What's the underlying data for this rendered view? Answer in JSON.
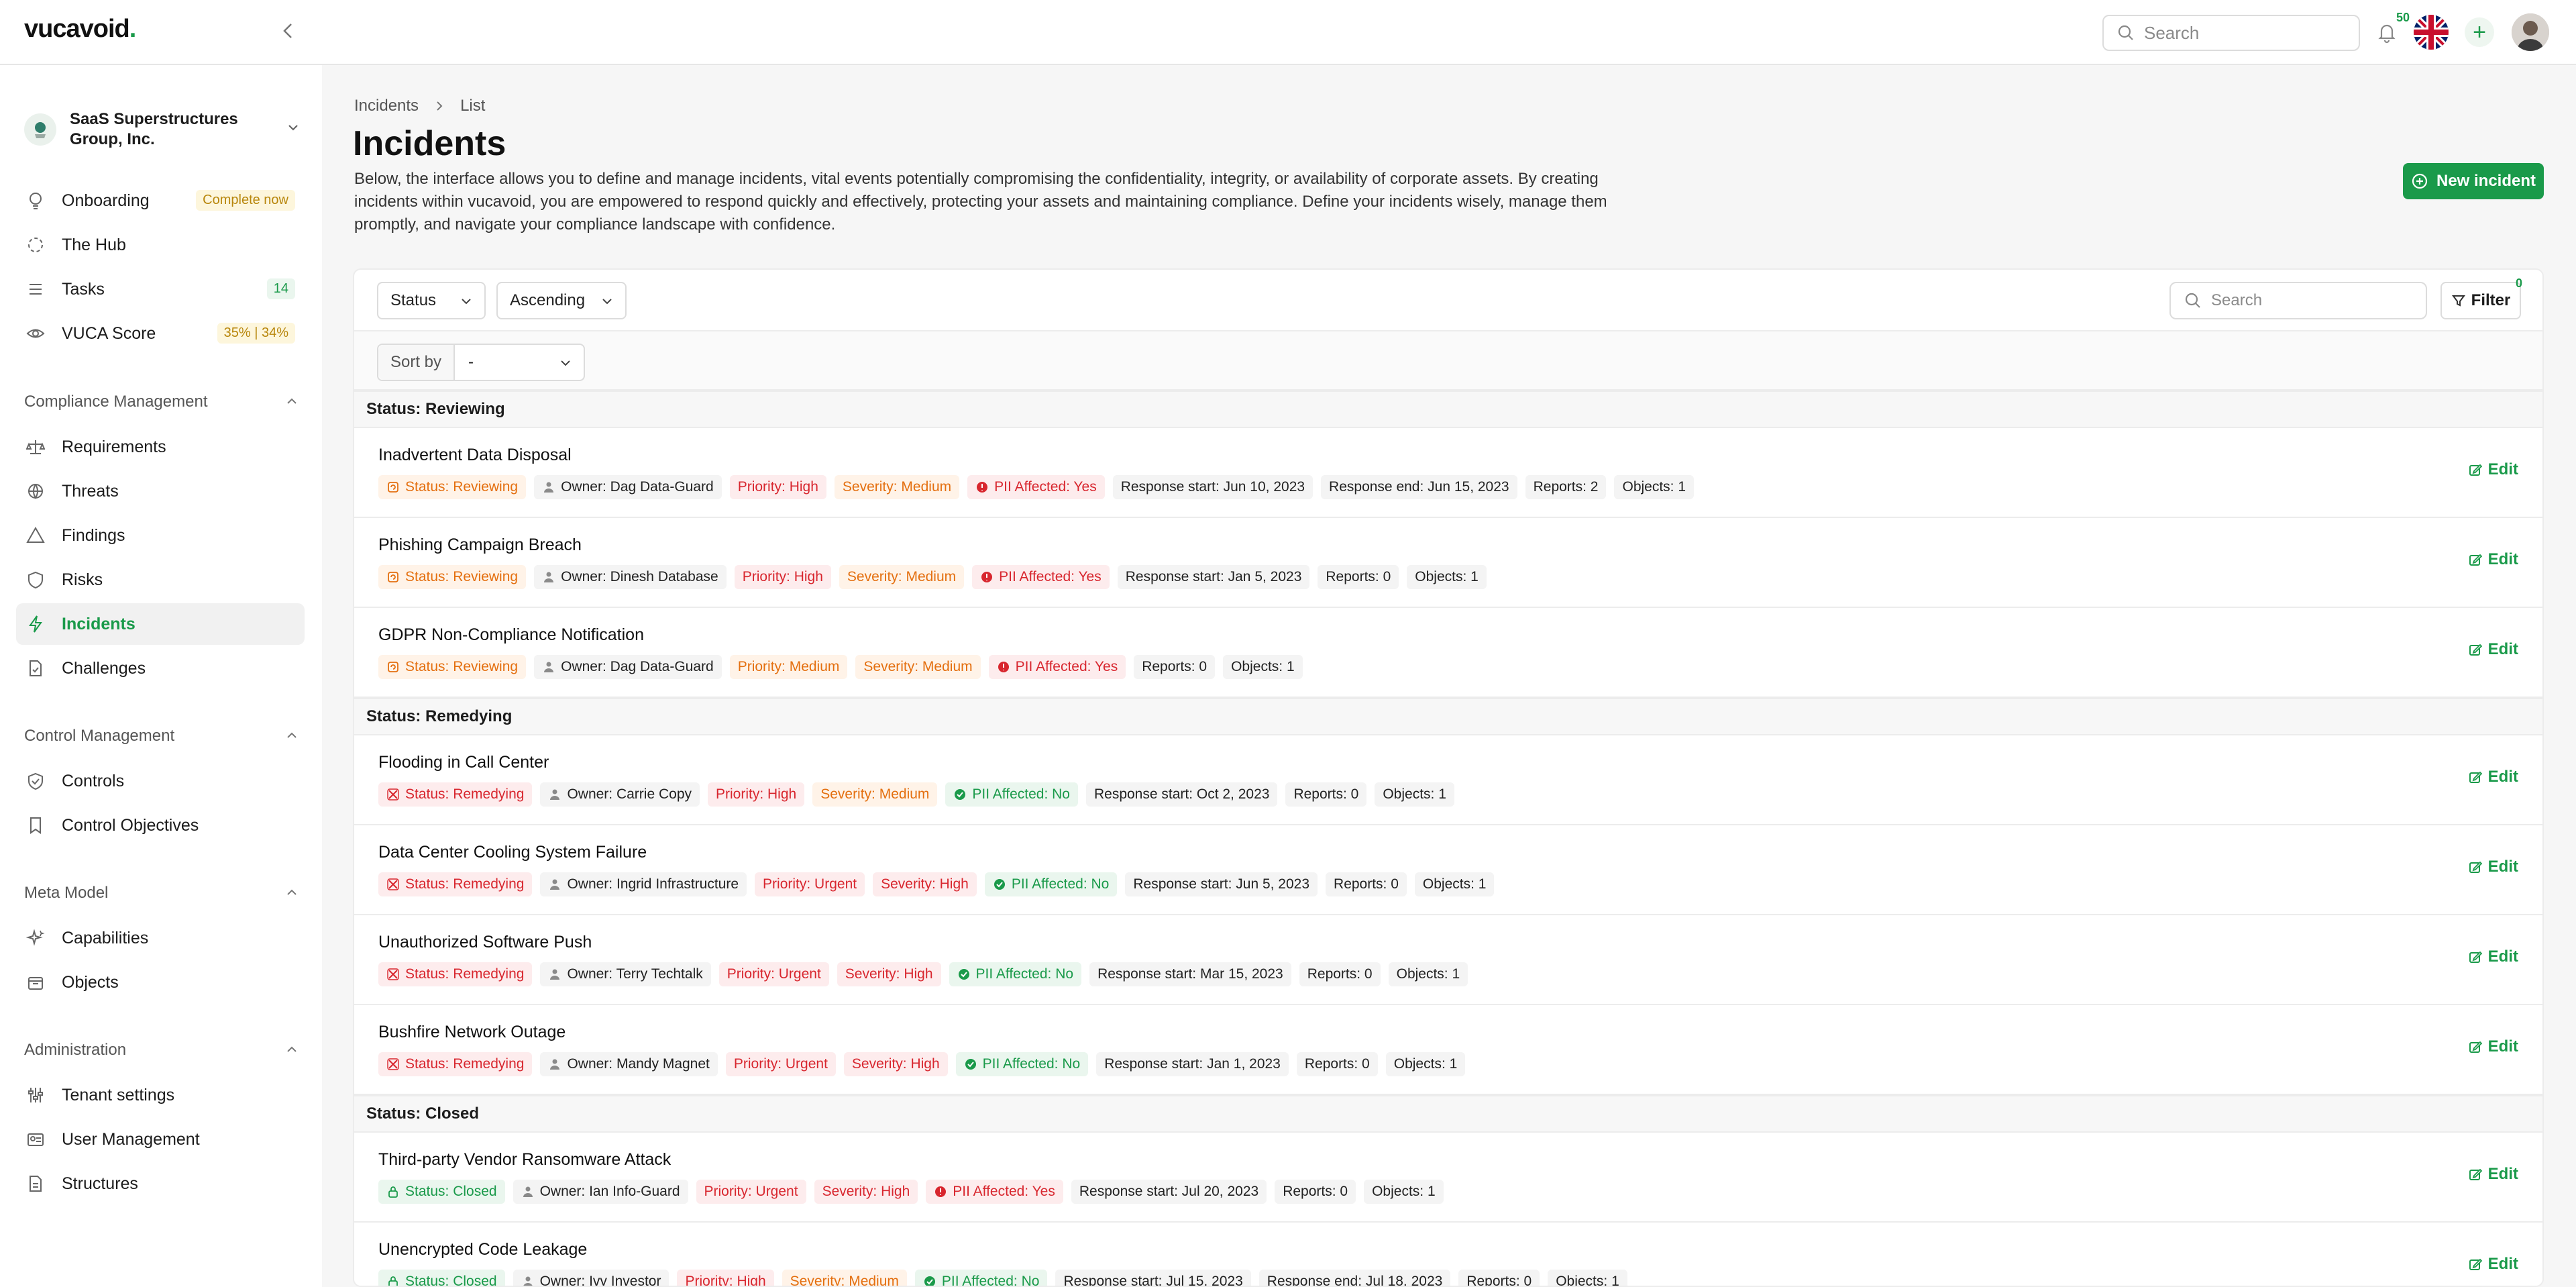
{
  "app": {
    "logo": "vucavoid",
    "logo_dot": "."
  },
  "topbar": {
    "search_placeholder": "Search",
    "notifications_count": "50"
  },
  "tenant": {
    "name": "SaaS Superstructures Group, Inc."
  },
  "sidebar": {
    "top_items": [
      {
        "label": "Onboarding",
        "badge": "Complete now",
        "icon": "lightbulb-icon"
      },
      {
        "label": "The Hub",
        "icon": "hub-icon"
      },
      {
        "label": "Tasks",
        "badge": "14",
        "icon": "tasks-icon"
      },
      {
        "label": "VUCA Score",
        "badge": "35% | 34%",
        "icon": "eye-icon"
      }
    ],
    "sections": [
      {
        "title": "Compliance Management",
        "items": [
          "Requirements",
          "Threats",
          "Findings",
          "Risks",
          "Incidents",
          "Challenges"
        ]
      },
      {
        "title": "Control Management",
        "items": [
          "Controls",
          "Control Objectives"
        ]
      },
      {
        "title": "Meta Model",
        "items": [
          "Capabilities",
          "Objects"
        ]
      },
      {
        "title": "Administration",
        "items": [
          "Tenant settings",
          "User Management",
          "Structures"
        ]
      }
    ]
  },
  "breadcrumb": [
    "Incidents",
    "List"
  ],
  "page": {
    "title": "Incidents",
    "description": "Below, the interface allows you to define and manage incidents, vital events potentially compromising the confidentiality, integrity, or availability of corporate assets. By creating incidents within vucavoid, you are empowered to respond quickly and effectively, protecting your assets and maintaining compliance. Define your incidents wisely, manage them promptly, and navigate your compliance landscape with confidence.",
    "new_button": "New incident"
  },
  "toolbar": {
    "status_select": "Status",
    "order_select": "Ascending",
    "search_placeholder": "Search",
    "filter_label": "Filter",
    "filter_count": "0",
    "sort_by_label": "Sort by",
    "sort_by_value": "-"
  },
  "edit_label": "Edit",
  "groups": [
    {
      "title": "Status: Reviewing",
      "rows": [
        {
          "title": "Inadvertent Data Disposal",
          "status": "Status: Reviewing",
          "owner": "Owner: Dag Data-Guard",
          "priority": "Priority: High",
          "severity": "Severity: Medium",
          "pii": "PII Affected: Yes",
          "extra": [
            "Response start: Jun 10, 2023",
            "Response end: Jun 15, 2023",
            "Reports: 2",
            "Objects: 1"
          ]
        },
        {
          "title": "Phishing Campaign Breach",
          "status": "Status: Reviewing",
          "owner": "Owner: Dinesh Database",
          "priority": "Priority: High",
          "severity": "Severity: Medium",
          "pii": "PII Affected: Yes",
          "extra": [
            "Response start: Jan 5, 2023",
            "Reports: 0",
            "Objects: 1"
          ]
        },
        {
          "title": "GDPR Non-Compliance Notification",
          "status": "Status: Reviewing",
          "owner": "Owner: Dag Data-Guard",
          "priority": "Priority: Medium",
          "severity": "Severity: Medium",
          "pii": "PII Affected: Yes",
          "extra": [
            "Reports: 0",
            "Objects: 1"
          ]
        }
      ]
    },
    {
      "title": "Status: Remedying",
      "rows": [
        {
          "title": "Flooding in Call Center",
          "status": "Status: Remedying",
          "owner": "Owner: Carrie Copy",
          "priority": "Priority: High",
          "severity": "Severity: Medium",
          "pii": "PII Affected: No",
          "extra": [
            "Response start: Oct 2, 2023",
            "Reports: 0",
            "Objects: 1"
          ]
        },
        {
          "title": "Data Center Cooling System Failure",
          "status": "Status: Remedying",
          "owner": "Owner: Ingrid Infrastructure",
          "priority": "Priority: Urgent",
          "severity": "Severity: High",
          "pii": "PII Affected: No",
          "extra": [
            "Response start: Jun 5, 2023",
            "Reports: 0",
            "Objects: 1"
          ]
        },
        {
          "title": "Unauthorized Software Push",
          "status": "Status: Remedying",
          "owner": "Owner: Terry Techtalk",
          "priority": "Priority: Urgent",
          "severity": "Severity: High",
          "pii": "PII Affected: No",
          "extra": [
            "Response start: Mar 15, 2023",
            "Reports: 0",
            "Objects: 1"
          ]
        },
        {
          "title": "Bushfire Network Outage",
          "status": "Status: Remedying",
          "owner": "Owner: Mandy Magnet",
          "priority": "Priority: Urgent",
          "severity": "Severity: High",
          "pii": "PII Affected: No",
          "extra": [
            "Response start: Jan 1, 2023",
            "Reports: 0",
            "Objects: 1"
          ]
        }
      ]
    },
    {
      "title": "Status: Closed",
      "rows": [
        {
          "title": "Third-party Vendor Ransomware Attack",
          "status": "Status: Closed",
          "owner": "Owner: Ian Info-Guard",
          "priority": "Priority: Urgent",
          "severity": "Severity: High",
          "pii": "PII Affected: Yes",
          "extra": [
            "Response start: Jul 20, 2023",
            "Reports: 0",
            "Objects: 1"
          ]
        },
        {
          "title": "Unencrypted Code Leakage",
          "status": "Status: Closed",
          "owner": "Owner: Ivy Investor",
          "priority": "Priority: High",
          "severity": "Severity: Medium",
          "pii": "PII Affected: No",
          "extra": [
            "Response start: Jul 15, 2023",
            "Response end: Jul 18, 2023",
            "Reports: 0",
            "Objects: 1"
          ]
        }
      ]
    }
  ],
  "colors": {
    "accent": "#1a9a4a",
    "warning": "#e46f0f",
    "danger": "#d8262e"
  }
}
